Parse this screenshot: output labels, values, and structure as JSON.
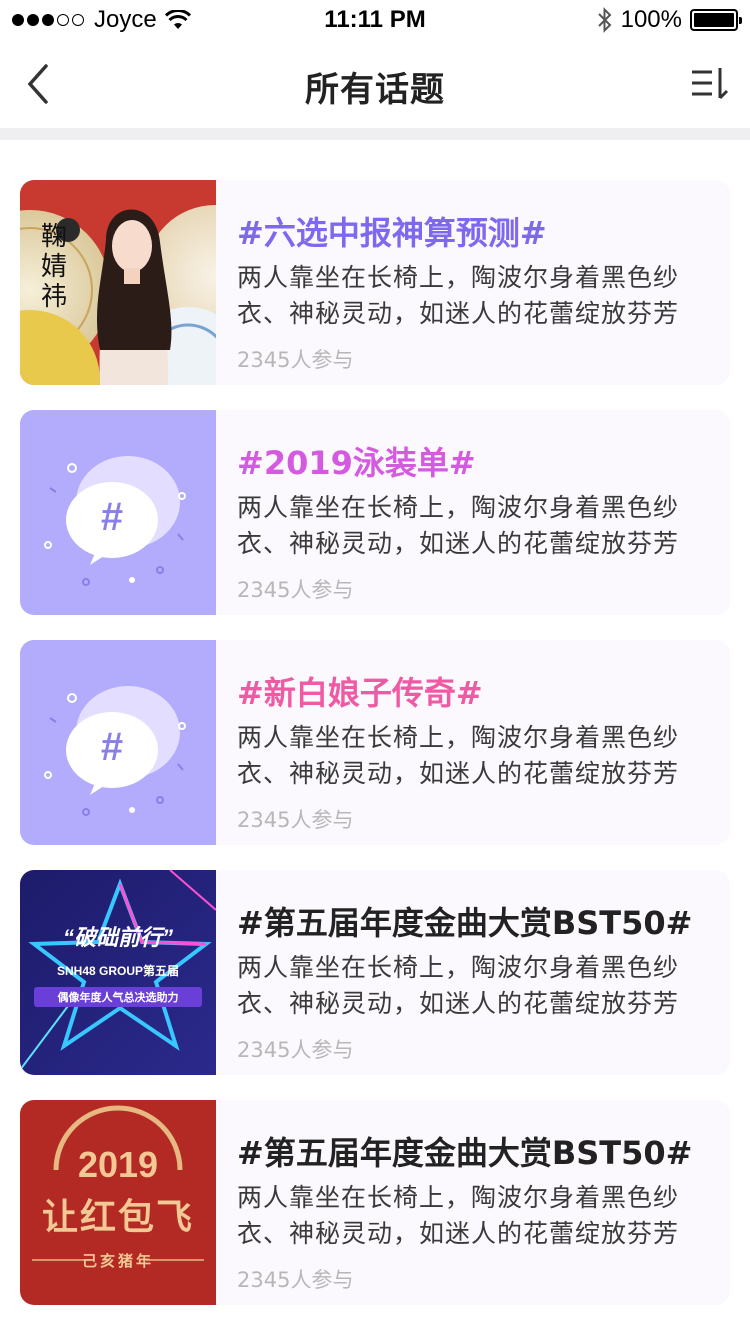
{
  "status_bar": {
    "carrier": "Joyce",
    "time": "11:11 PM",
    "battery": "100%"
  },
  "nav": {
    "title": "所有话题",
    "back_icon": "chevron-left-icon",
    "menu_icon": "filter-menu-icon"
  },
  "colors": {
    "purple_title": "#7e68f0",
    "magenta_title": "#d45ae0",
    "pink_title": "#ee5aa3",
    "dark_title": "#222222",
    "card_bg": "#fbf8fe",
    "placeholder_bg": "#b3abfb"
  },
  "topics": [
    {
      "title": "#六选中报神算预测#",
      "description": "两人靠坐在长椅上，陶波尔身着黑色纱衣、神秘灵动，如迷人的花蕾绽放芬芳",
      "participants": "2345人参与",
      "thumb_text": [
        "鞠",
        "婧",
        "祎"
      ]
    },
    {
      "title": "#2019泳装单#",
      "description": "两人靠坐在长椅上，陶波尔身着黑色纱衣、神秘灵动，如迷人的花蕾绽放芬芳",
      "participants": "2345人参与",
      "thumb_text": "#"
    },
    {
      "title": "#新白娘子传奇#",
      "description": "两人靠坐在长椅上，陶波尔身着黑色纱衣、神秘灵动，如迷人的花蕾绽放芬芳",
      "participants": "2345人参与",
      "thumb_text": "#"
    },
    {
      "title": "#第五届年度金曲大赏BST50#",
      "description": "两人靠坐在长椅上，陶波尔身着黑色纱衣、神秘灵动，如迷人的花蕾绽放芬芳",
      "participants": "2345人参与",
      "thumb_text": [
        "“破础前行”",
        "SNH48 GROUP第五届",
        "偶像年度人气总决选助力"
      ]
    },
    {
      "title": "#第五届年度金曲大赏BST50#",
      "description": "两人靠坐在长椅上，陶波尔身着黑色纱衣、神秘灵动，如迷人的花蕾绽放芬芳",
      "participants": "2345人参与",
      "thumb_text": [
        "2019",
        "让红包飞",
        "己亥猪年"
      ]
    }
  ]
}
